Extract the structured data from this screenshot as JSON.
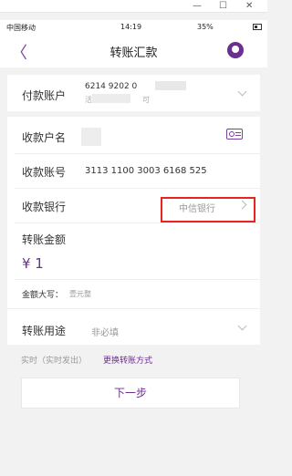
{
  "window": {
    "minimize": "—",
    "maximize": "☐",
    "close": "✕"
  },
  "status": {
    "carrier": "中国移动",
    "time": "14:19",
    "right": "35%"
  },
  "nav": {
    "back": "〈",
    "title": "转账汇款"
  },
  "payer": {
    "label": "付款账户",
    "account_line1": "6214 9202 0",
    "account_line2_prefix": "活",
    "account_line2_suffix": "可"
  },
  "payee": {
    "name_label": "收款户名",
    "account_label": "收款账号",
    "account_number": "3113 1100 3003 6168 525",
    "bank_label": "收款银行",
    "bank_value": "中信银行"
  },
  "amount": {
    "label": "转账金额",
    "value": "¥ 1",
    "caps_label": "金额大写：",
    "caps_value": "壹元整"
  },
  "purpose": {
    "label": "转账用途",
    "placeholder": "非必填"
  },
  "mode": {
    "realtime": "实时（实时发出）",
    "change": "更换转账方式"
  },
  "actions": {
    "next": "下一步"
  },
  "colors": {
    "brand": "#6b2f8f",
    "highlight": "#e8241c"
  }
}
